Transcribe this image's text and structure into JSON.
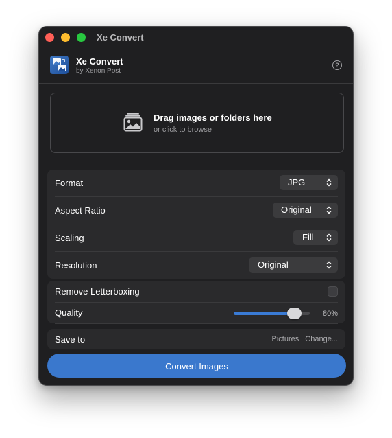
{
  "window": {
    "title": "Xe Convert"
  },
  "header": {
    "app_name": "Xe Convert",
    "byline": "by Xenon Post",
    "help_glyph": "?"
  },
  "dropzone": {
    "title": "Drag images or folders here",
    "subtitle": "or click to browse",
    "icon": "photo-stack-icon"
  },
  "settings": {
    "format": {
      "label": "Format",
      "value": "JPG"
    },
    "aspect_ratio": {
      "label": "Aspect Ratio",
      "value": "Original"
    },
    "scaling": {
      "label": "Scaling",
      "value": "Fill"
    },
    "resolution": {
      "label": "Resolution",
      "value": "Original"
    }
  },
  "options": {
    "remove_letterboxing": {
      "label": "Remove Letterboxing",
      "checked": false
    },
    "quality": {
      "label": "Quality",
      "value_text": "80%",
      "value": 0.8
    }
  },
  "save": {
    "label": "Save to",
    "location": "Pictures",
    "change_label": "Change..."
  },
  "actions": {
    "convert_label": "Convert Images"
  },
  "colors": {
    "accent": "#3a78cd",
    "window_bg": "#1f1f21",
    "group_bg": "#2a2a2c",
    "close": "#ff5f57",
    "minimize": "#febc2e",
    "maximize": "#28c840"
  }
}
